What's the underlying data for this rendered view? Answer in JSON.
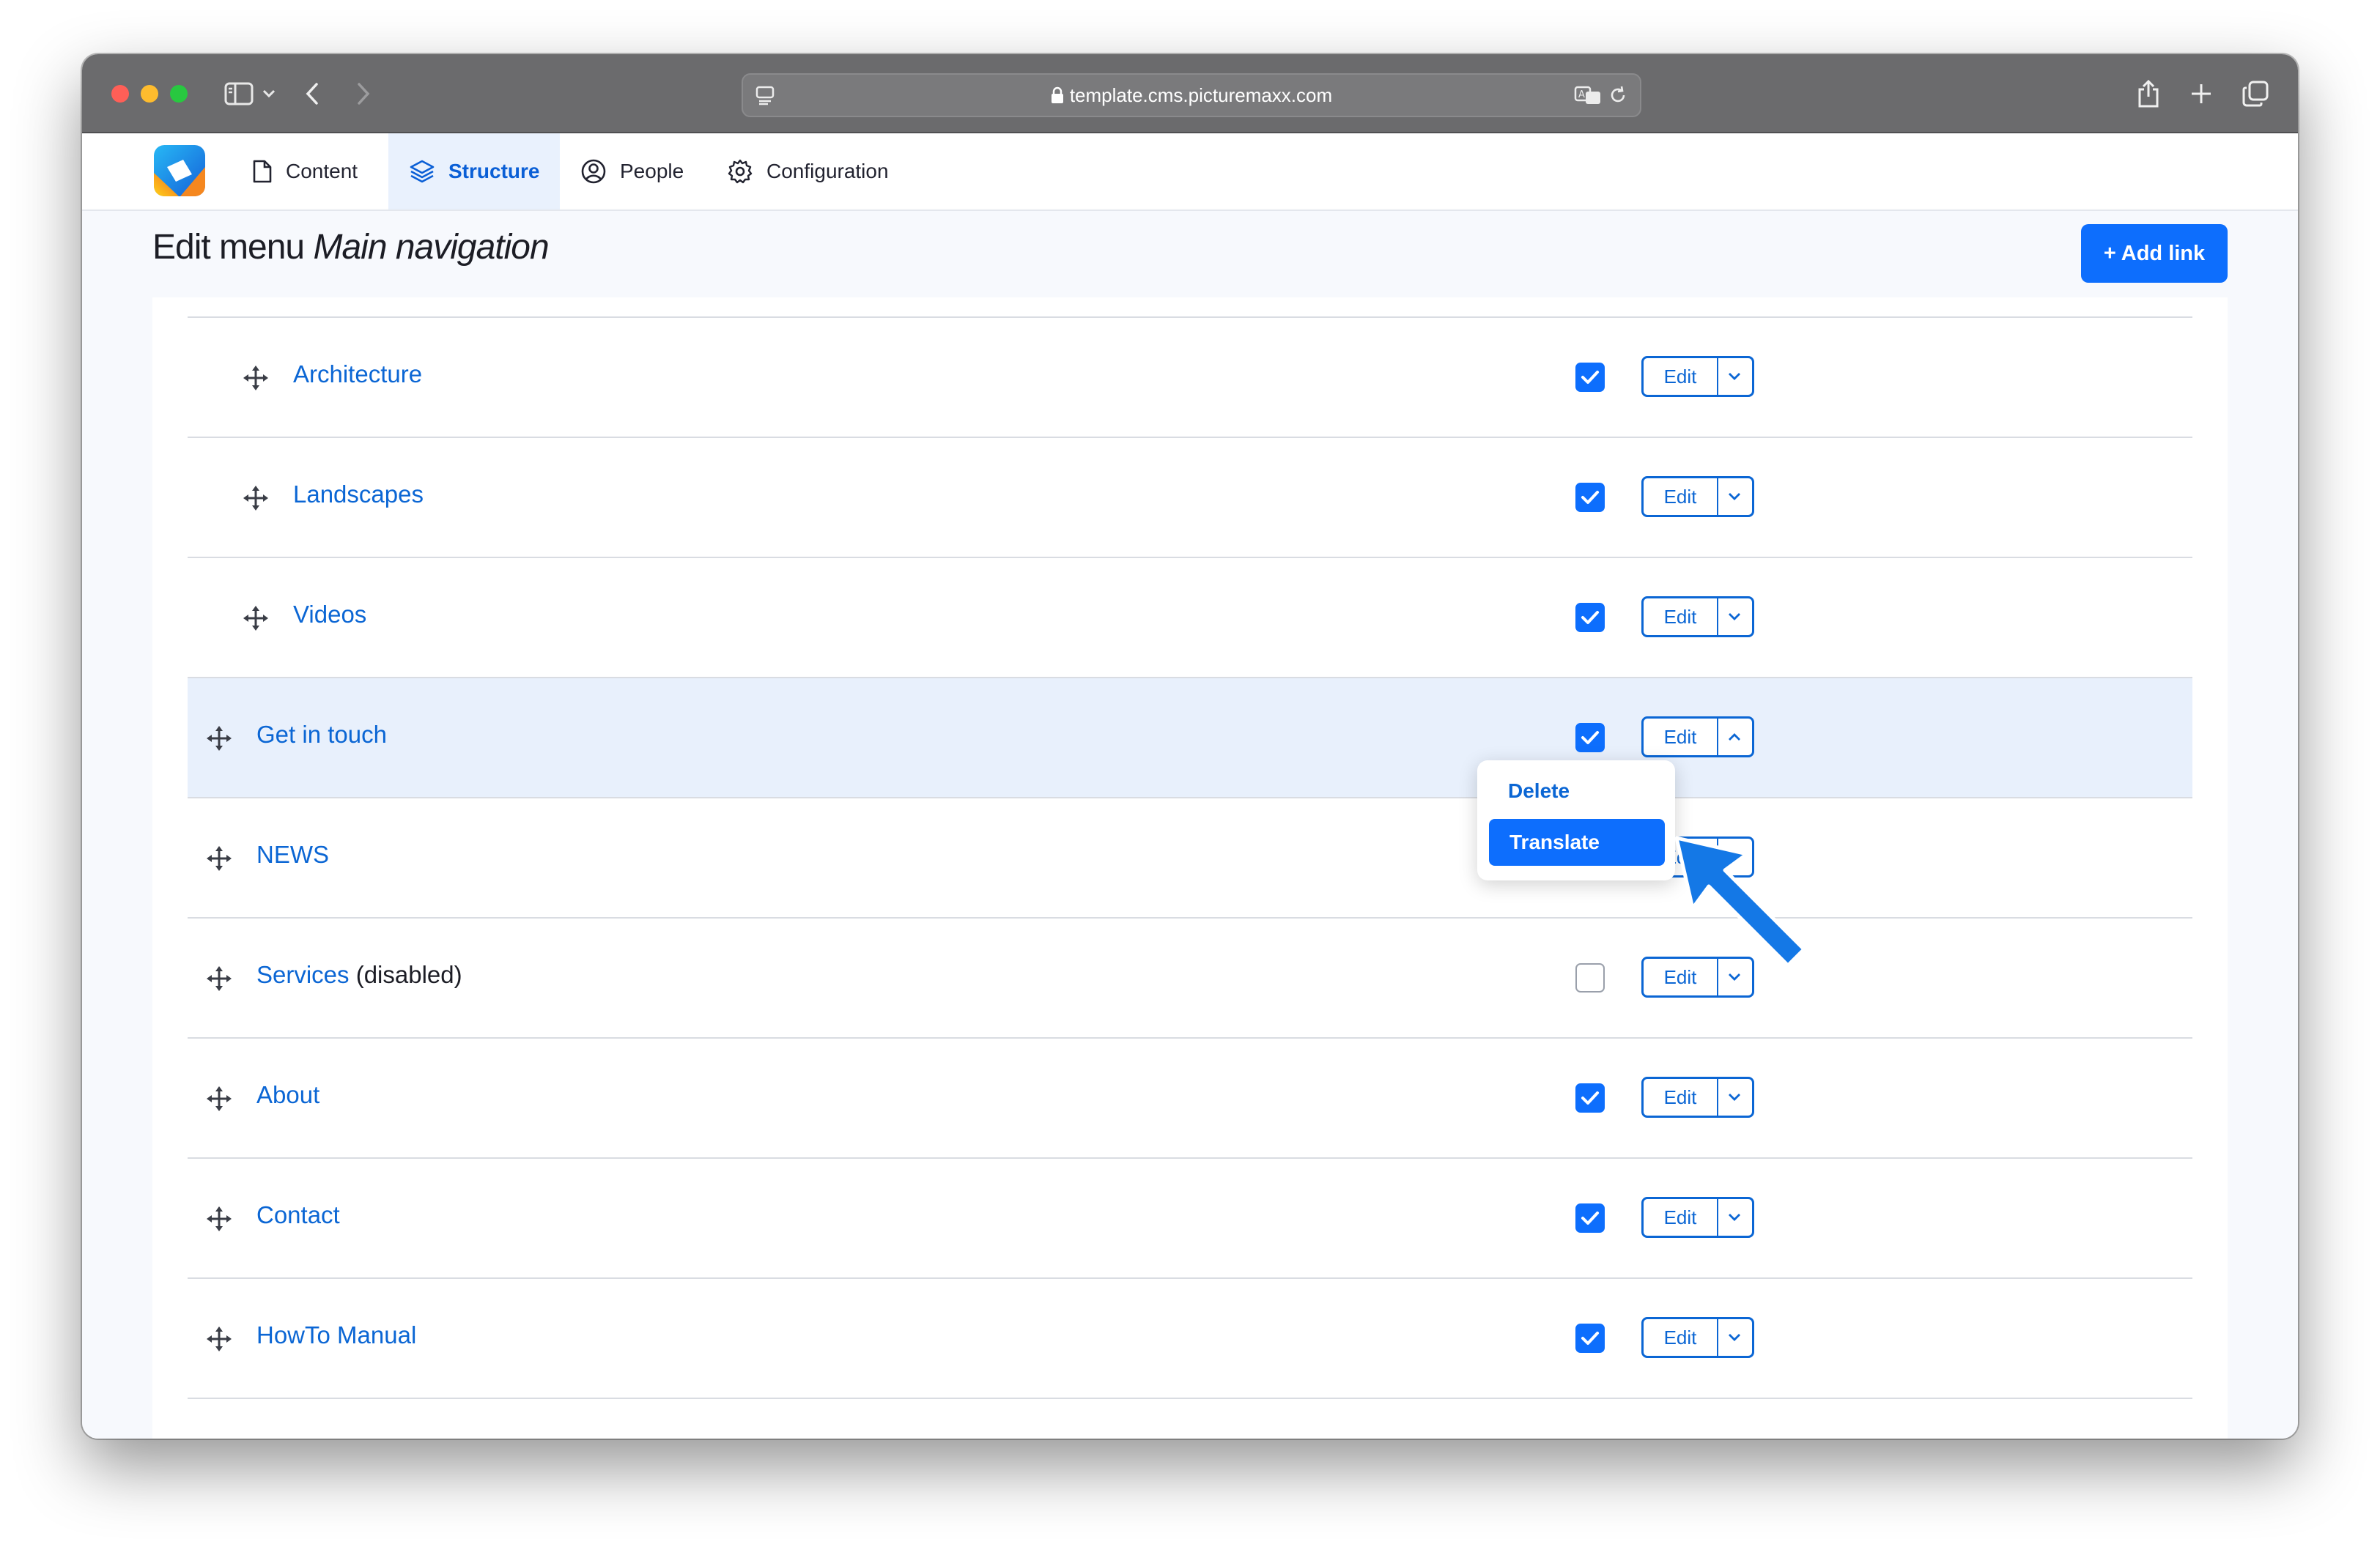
{
  "browser": {
    "url": "template.cms.picturemaxx.com"
  },
  "toolbar": {
    "items": [
      {
        "label": "Content",
        "icon": "document-icon"
      },
      {
        "label": "Structure",
        "icon": "layers-icon",
        "active": true
      },
      {
        "label": "People",
        "icon": "user-circle-icon"
      },
      {
        "label": "Configuration",
        "icon": "gear-icon"
      }
    ]
  },
  "page": {
    "title_prefix": "Edit menu",
    "title_menu": "Main navigation",
    "add_link_label": "+ Add link"
  },
  "menu_links": [
    {
      "title": "Architecture",
      "enabled": true,
      "indent": 1
    },
    {
      "title": "Landscapes",
      "enabled": true,
      "indent": 1
    },
    {
      "title": "Videos",
      "enabled": true,
      "indent": 1
    },
    {
      "title": "Get in touch",
      "enabled": true,
      "indent": 0,
      "highlighted": true,
      "dropdown_open": true
    },
    {
      "title": "NEWS",
      "enabled": true,
      "indent": 0
    },
    {
      "title": "Services",
      "suffix": "(disabled)",
      "enabled": false,
      "indent": 0
    },
    {
      "title": "About",
      "enabled": true,
      "indent": 0
    },
    {
      "title": "Contact",
      "enabled": true,
      "indent": 0
    },
    {
      "title": "HowTo Manual",
      "enabled": true,
      "indent": 0
    }
  ],
  "row_actions": {
    "edit_label": "Edit"
  },
  "dropdown": {
    "delete_label": "Delete",
    "translate_label": "Translate"
  },
  "colors": {
    "accent": "#0d6efd",
    "link": "#0b66d4",
    "highlight_row": "#e8f0fc",
    "arrow": "#1478e6"
  }
}
